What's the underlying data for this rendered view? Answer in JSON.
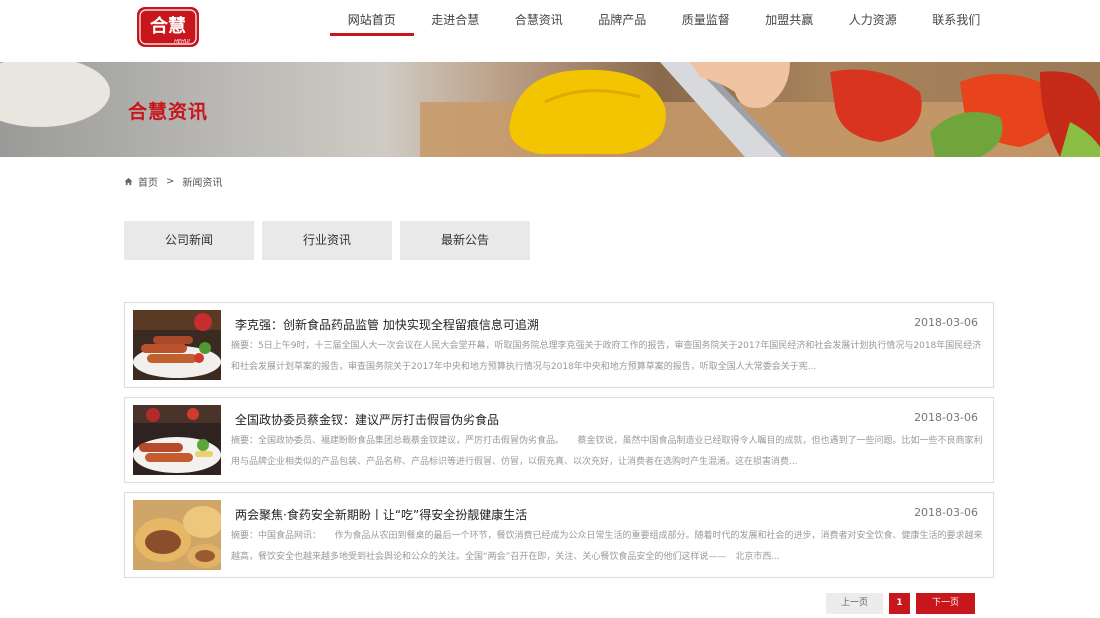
{
  "logo": {
    "brand": "合慧",
    "sub": "HEHUI"
  },
  "nav": {
    "items": [
      {
        "label": "网站首页",
        "active": true
      },
      {
        "label": "走进合慧",
        "active": false
      },
      {
        "label": "合慧资讯",
        "active": false
      },
      {
        "label": "品牌产品",
        "active": false
      },
      {
        "label": "质量监督",
        "active": false
      },
      {
        "label": "加盟共赢",
        "active": false
      },
      {
        "label": "人力资源",
        "active": false
      },
      {
        "label": "联系我们",
        "active": false
      }
    ]
  },
  "banner": {
    "title": "合慧资讯"
  },
  "breadcrumb": {
    "home": "首页",
    "sep": ">",
    "current": "新闻资讯"
  },
  "tabs": [
    "公司新闻",
    "行业资讯",
    "最新公告"
  ],
  "news": [
    {
      "title": "李克强：创新食品药品监管 加快实现全程留痕信息可追溯",
      "date": "2018-03-06",
      "summary": "摘要：5日上午9时，十三届全国人大一次会议在人民大会堂开幕，听取国务院总理李克强关于政府工作的报告，审查国务院关于2017年国民经济和社会发展计划执行情况与2018年国民经济和社会发展计划草案的报告，审查国务院关于2017年中央和地方预算执行情况与2018年中央和地方预算草案的报告，听取全国人大常委会关于宪..."
    },
    {
      "title": "全国政协委员蔡金钗：建议严厉打击假冒伪劣食品",
      "date": "2018-03-06",
      "summary": "摘要：全国政协委员、福建盼盼食品集团总裁蔡金钗建议，严厉打击假冒伪劣食品。　　蔡金钗说，虽然中国食品制造业已经取得令人瞩目的成就，但也遇到了一些问题。比如一些不良商家利用与品牌企业相类似的产品包装、产品名称、产品标识等进行假冒、仿冒，以假充真、以次充好，让消费者在选购时产生混淆。这在损害消费..."
    },
    {
      "title": "两会聚焦·食药安全新期盼丨让“吃”得安全扮靓健康生活",
      "date": "2018-03-06",
      "summary": "摘要：中国食品网讯：　　作为食品从农田到餐桌的最后一个环节，餐饮消费已经成为公众日常生活的重要组成部分。随着时代的发展和社会的进步，消费者对安全饮食、健康生活的要求越来越高，餐饮安全也越来越多地受到社会舆论和公众的关注。全国“两会”召开在即，关注、关心餐饮食品安全的他们这样说——　北京市西..."
    }
  ],
  "pager": {
    "prev": "上一页",
    "current": "1",
    "next": "下一页"
  },
  "colors": {
    "accent": "#c8161d",
    "tab_bg": "#e9e9e9",
    "border": "#dcdcdc"
  }
}
